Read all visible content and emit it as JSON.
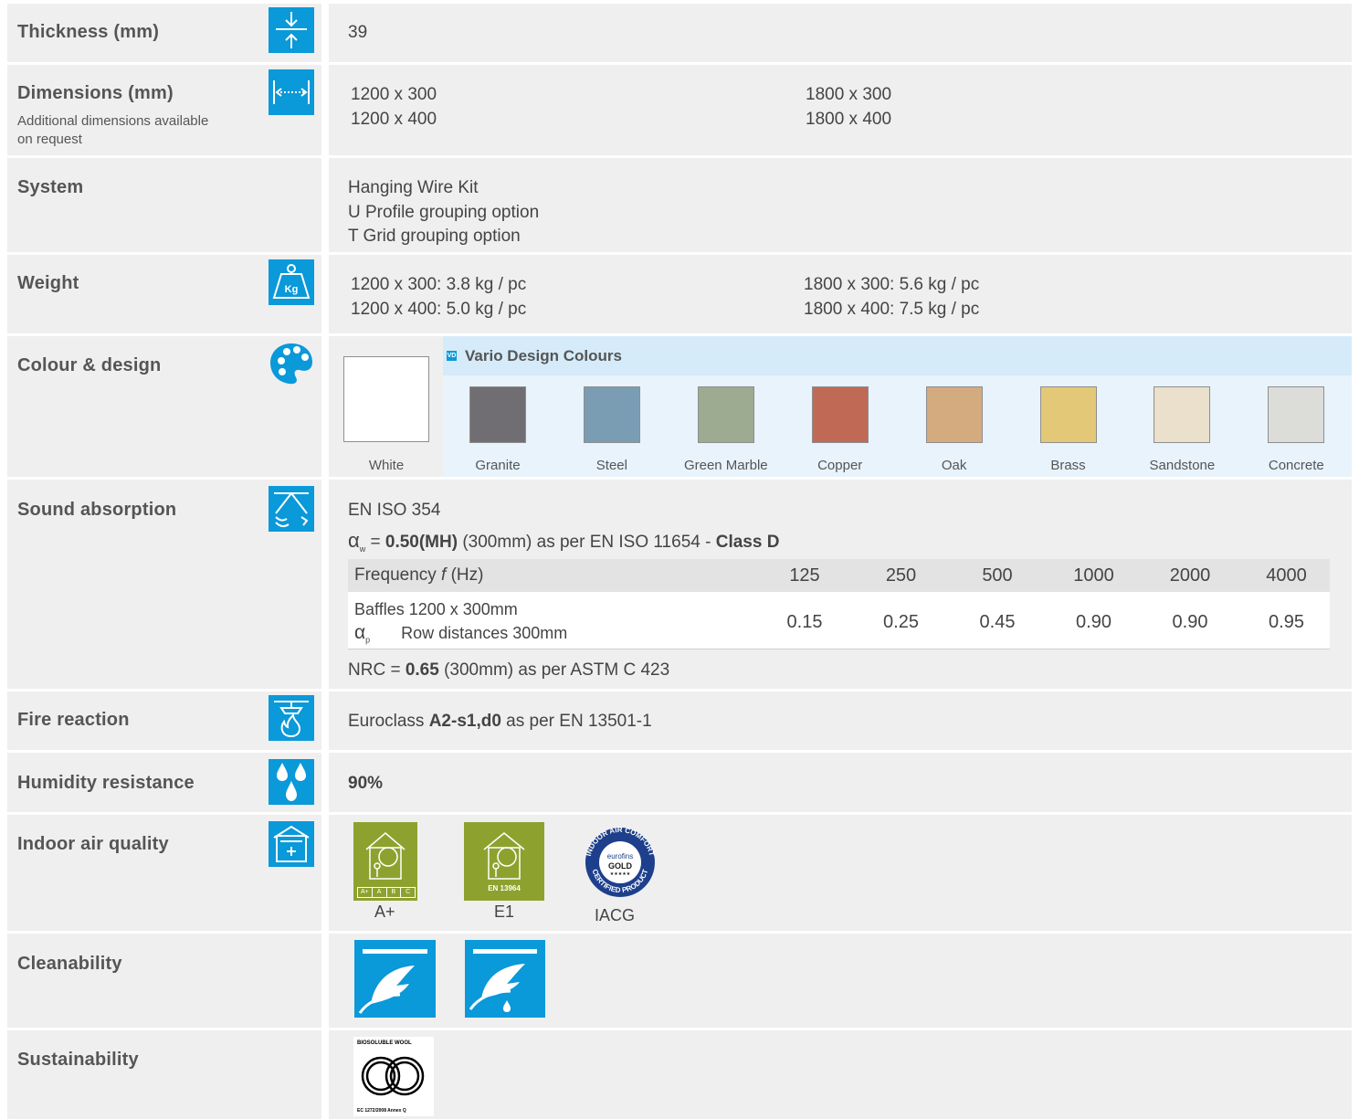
{
  "thickness": {
    "label": "Thickness (mm)",
    "value": "39",
    "icon": "thickness-icon"
  },
  "dimensions": {
    "label": "Dimensions (mm)",
    "note": "Additional dimensions available on request",
    "icon": "dimensions-icon",
    "col1": [
      "1200 x 300",
      "1200 x 400"
    ],
    "col2": [
      "1800 x 300",
      "1800 x 400"
    ]
  },
  "system": {
    "label": "System",
    "items": [
      "Hanging Wire Kit",
      "U Profile grouping option",
      "T Grid grouping option"
    ]
  },
  "weight": {
    "label": "Weight",
    "icon": "weight-kg-icon",
    "icon_text": "Kg",
    "col1": [
      "1200 x 300: 3.8 kg / pc",
      "1200 x 400: 5.0 kg / pc"
    ],
    "col2": [
      "1800 x 300: 5.6 kg / pc",
      "1800 x 400: 7.5 kg / pc"
    ]
  },
  "colour": {
    "label": "Colour & design",
    "icon": "palette-icon",
    "vario_badge": "VD",
    "vario_title": "Vario Design Colours",
    "white": {
      "name": "White",
      "hex": "#ffffff"
    },
    "swatches": [
      {
        "name": "Granite",
        "hex": "#706d73"
      },
      {
        "name": "Steel",
        "hex": "#7a9db3"
      },
      {
        "name": "Green Marble",
        "hex": "#9dab91"
      },
      {
        "name": "Copper",
        "hex": "#c06a55"
      },
      {
        "name": "Oak",
        "hex": "#d4aa7f"
      },
      {
        "name": "Brass",
        "hex": "#e3c877"
      },
      {
        "name": "Sandstone",
        "hex": "#eae0cb"
      },
      {
        "name": "Concrete",
        "hex": "#dcdcd8"
      }
    ]
  },
  "sound": {
    "label": "Sound absorption",
    "icon": "sound-absorption-icon",
    "standard": "EN ISO 354",
    "aw_symbol": "α",
    "aw_sub": "w",
    "aw_eq": " = ",
    "aw_value": "0.50(MH)",
    "aw_mid": " (300mm) as per EN ISO 11654 - ",
    "aw_class": "Class D",
    "freq_label": "Frequency ",
    "freq_f": "f",
    "freq_unit": " (Hz)",
    "frequencies": [
      "125",
      "250",
      "500",
      "1000",
      "2000",
      "4000"
    ],
    "row_line1": "Baffles 1200 x 300mm",
    "row_symbol": "α",
    "row_sub": "p",
    "row_line2": "Row distances 300mm",
    "values": [
      "0.15",
      "0.25",
      "0.45",
      "0.90",
      "0.90",
      "0.95"
    ],
    "nrc_pre": "NRC = ",
    "nrc_value": "0.65",
    "nrc_post": " (300mm) as per ASTM C 423"
  },
  "fire": {
    "label": "Fire reaction",
    "icon": "fire-reaction-icon",
    "pre": "Euroclass ",
    "class": "A2-s1,d0",
    "post": " as per EN 13501-1"
  },
  "humidity": {
    "label": "Humidity resistance",
    "icon": "humidity-drops-icon",
    "value": "90%"
  },
  "indoor": {
    "label": "Indoor air quality",
    "icon": "indoor-air-icon",
    "a_label": "A+",
    "a_scale": [
      "A+",
      "A",
      "B",
      "C"
    ],
    "e_label": "E1",
    "e_standard": "EN 13964",
    "iacg_label": "IACG",
    "iacg_top": "INDOOR AIR COMFORT",
    "iacg_bottom": "CERTIFIED PRODUCT",
    "iacg_brand": "eurofins",
    "iacg_gold": "GOLD",
    "iacg_stars": "★★★★★"
  },
  "clean": {
    "label": "Cleanability",
    "icons": [
      "dust-cleaning-icon",
      "wet-cleaning-icon"
    ]
  },
  "sustain": {
    "label": "Sustainability",
    "badge_top": "BIOSOLUBLE WOOL",
    "badge_bottom": "EC 1272/2008 Annex Q"
  }
}
